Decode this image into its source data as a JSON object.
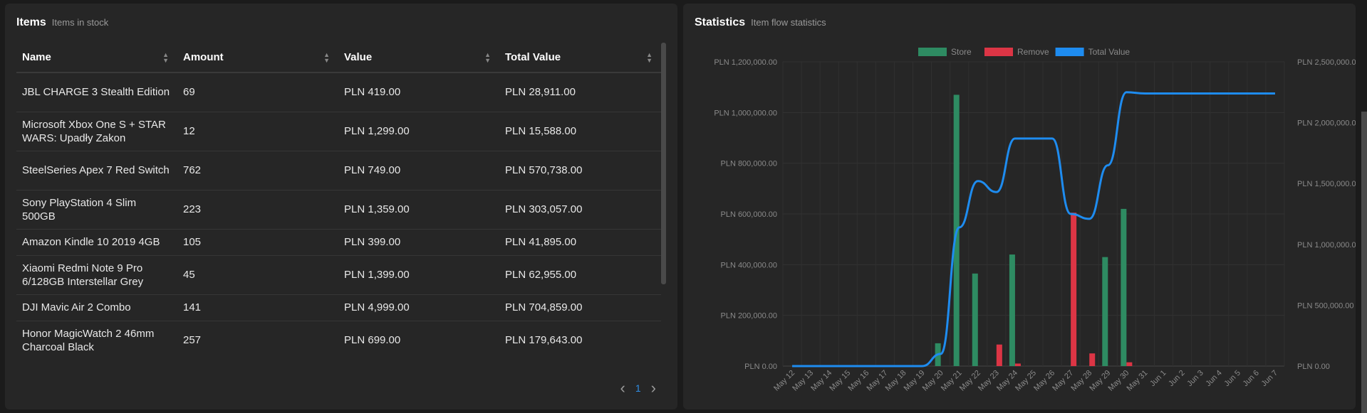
{
  "items_panel": {
    "title": "Items",
    "subtitle": "Items in stock",
    "columns": [
      "Name",
      "Amount",
      "Value",
      "Total Value"
    ],
    "rows": [
      {
        "name": "JBL CHARGE 3 Stealth Edition",
        "amount": "69",
        "value": "PLN 419.00",
        "total": "PLN 28,911.00"
      },
      {
        "name": "Microsoft Xbox One S + STAR WARS: Upadły Zakon",
        "amount": "12",
        "value": "PLN 1,299.00",
        "total": "PLN 15,588.00"
      },
      {
        "name": "SteelSeries Apex 7 Red Switch",
        "amount": "762",
        "value": "PLN 749.00",
        "total": "PLN 570,738.00"
      },
      {
        "name": "Sony PlayStation 4 Slim 500GB",
        "amount": "223",
        "value": "PLN 1,359.00",
        "total": "PLN 303,057.00"
      },
      {
        "name": "Amazon Kindle 10 2019 4GB",
        "amount": "105",
        "value": "PLN 399.00",
        "total": "PLN 41,895.00"
      },
      {
        "name": "Xiaomi Redmi Note 9 Pro 6/128GB Interstellar Grey",
        "amount": "45",
        "value": "PLN 1,399.00",
        "total": "PLN 62,955.00"
      },
      {
        "name": "DJI Mavic Air 2 Combo",
        "amount": "141",
        "value": "PLN 4,999.00",
        "total": "PLN 704,859.00"
      },
      {
        "name": "Honor MagicWatch 2 46mm Charcoal Black",
        "amount": "257",
        "value": "PLN 699.00",
        "total": "PLN 179,643.00"
      }
    ],
    "pagination": {
      "current_page": "1",
      "prev_icon": "chevron-left-icon",
      "next_icon": "chevron-right-icon"
    }
  },
  "stats_panel": {
    "title": "Statistics",
    "subtitle": "Item flow statistics"
  },
  "colors": {
    "store": "#2e8b62",
    "remove": "#dc3545",
    "total_value": "#1e8cf0",
    "accent": "#2f8de4"
  },
  "chart_data": {
    "type": "bar",
    "legend_placement": "top-center",
    "grid": true,
    "categories": [
      "May 12",
      "May 13",
      "May 14",
      "May 15",
      "May 16",
      "May 17",
      "May 18",
      "May 19",
      "May 20",
      "May 21",
      "May 22",
      "May 23",
      "May 24",
      "May 25",
      "May 26",
      "May 27",
      "May 28",
      "May 29",
      "May 30",
      "May 31",
      "Jun 1",
      "Jun 2",
      "Jun 3",
      "Jun 4",
      "Jun 5",
      "Jun 6",
      "Jun 7"
    ],
    "series": [
      {
        "name": "Store",
        "type": "bar",
        "axis": "left",
        "color": "#2e8b62",
        "values": [
          0,
          0,
          0,
          0,
          0,
          0,
          0,
          0,
          90000,
          1070000,
          365000,
          0,
          440000,
          0,
          0,
          0,
          0,
          430000,
          620000,
          0,
          0,
          0,
          0,
          0,
          0,
          0,
          0
        ]
      },
      {
        "name": "Remove",
        "type": "bar",
        "axis": "left",
        "color": "#dc3545",
        "values": [
          0,
          0,
          0,
          0,
          0,
          0,
          0,
          0,
          0,
          0,
          0,
          85000,
          10000,
          0,
          0,
          605000,
          50000,
          0,
          15000,
          0,
          0,
          0,
          0,
          0,
          0,
          0,
          0
        ]
      },
      {
        "name": "Total Value",
        "type": "line",
        "axis": "right",
        "color": "#1e8cf0",
        "values": [
          0,
          0,
          0,
          0,
          0,
          0,
          0,
          0,
          100000,
          1140000,
          1520000,
          1430000,
          1870000,
          1870000,
          1870000,
          1250000,
          1210000,
          1650000,
          2250000,
          2240000,
          2240000,
          2240000,
          2240000,
          2240000,
          2240000,
          2240000,
          2240000
        ]
      }
    ],
    "y_left": {
      "min": 0,
      "max": 1200000,
      "ticks": [
        "PLN 0.00",
        "PLN 200,000.00",
        "PLN 400,000.00",
        "PLN 600,000.00",
        "PLN 800,000.00",
        "PLN 1,000,000.00",
        "PLN 1,200,000.00"
      ]
    },
    "y_right": {
      "min": 0,
      "max": 2500000,
      "ticks": [
        "PLN 0.00",
        "PLN 500,000.00",
        "PLN 1,000,000.00",
        "PLN 1,500,000.00",
        "PLN 2,000,000.00",
        "PLN 2,500,000.00"
      ]
    }
  }
}
